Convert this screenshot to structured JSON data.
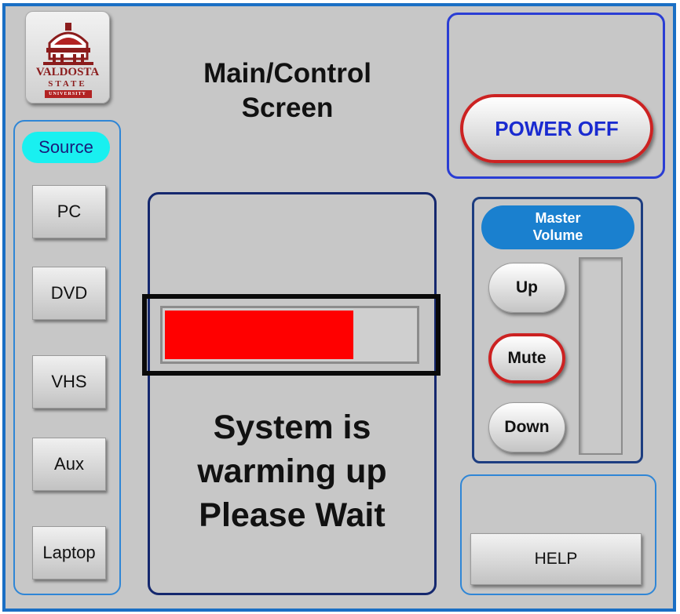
{
  "screen": {
    "title_line1": "Main/Control",
    "title_line2": "Screen"
  },
  "logo": {
    "line1": "VALDOSTA",
    "line2": "STATE",
    "line3": "UNIVERSITY",
    "icon": "university-dome-logo"
  },
  "source": {
    "label": "Source",
    "buttons": [
      "PC",
      "DVD",
      "VHS",
      "Aux",
      "Laptop"
    ]
  },
  "status": {
    "progress_fraction": 0.76,
    "line1": "System is",
    "line2": "warming up",
    "line3": "Please Wait"
  },
  "power": {
    "label": "POWER OFF"
  },
  "volume": {
    "label_line1": "Master",
    "label_line2": "Volume",
    "up_label": "Up",
    "mute_label": "Mute",
    "down_label": "Down",
    "level_fraction": 0
  },
  "help": {
    "label": "HELP"
  },
  "colors": {
    "frame_border": "#1a6fc4",
    "background": "#c7c7c7",
    "source_badge": "#19f0f0",
    "volume_badge": "#1a80cf",
    "power_border": "#cc2222",
    "power_text": "#1a2bd0",
    "progress_fill": "#ff0000",
    "status_panel_border": "#15286e"
  }
}
